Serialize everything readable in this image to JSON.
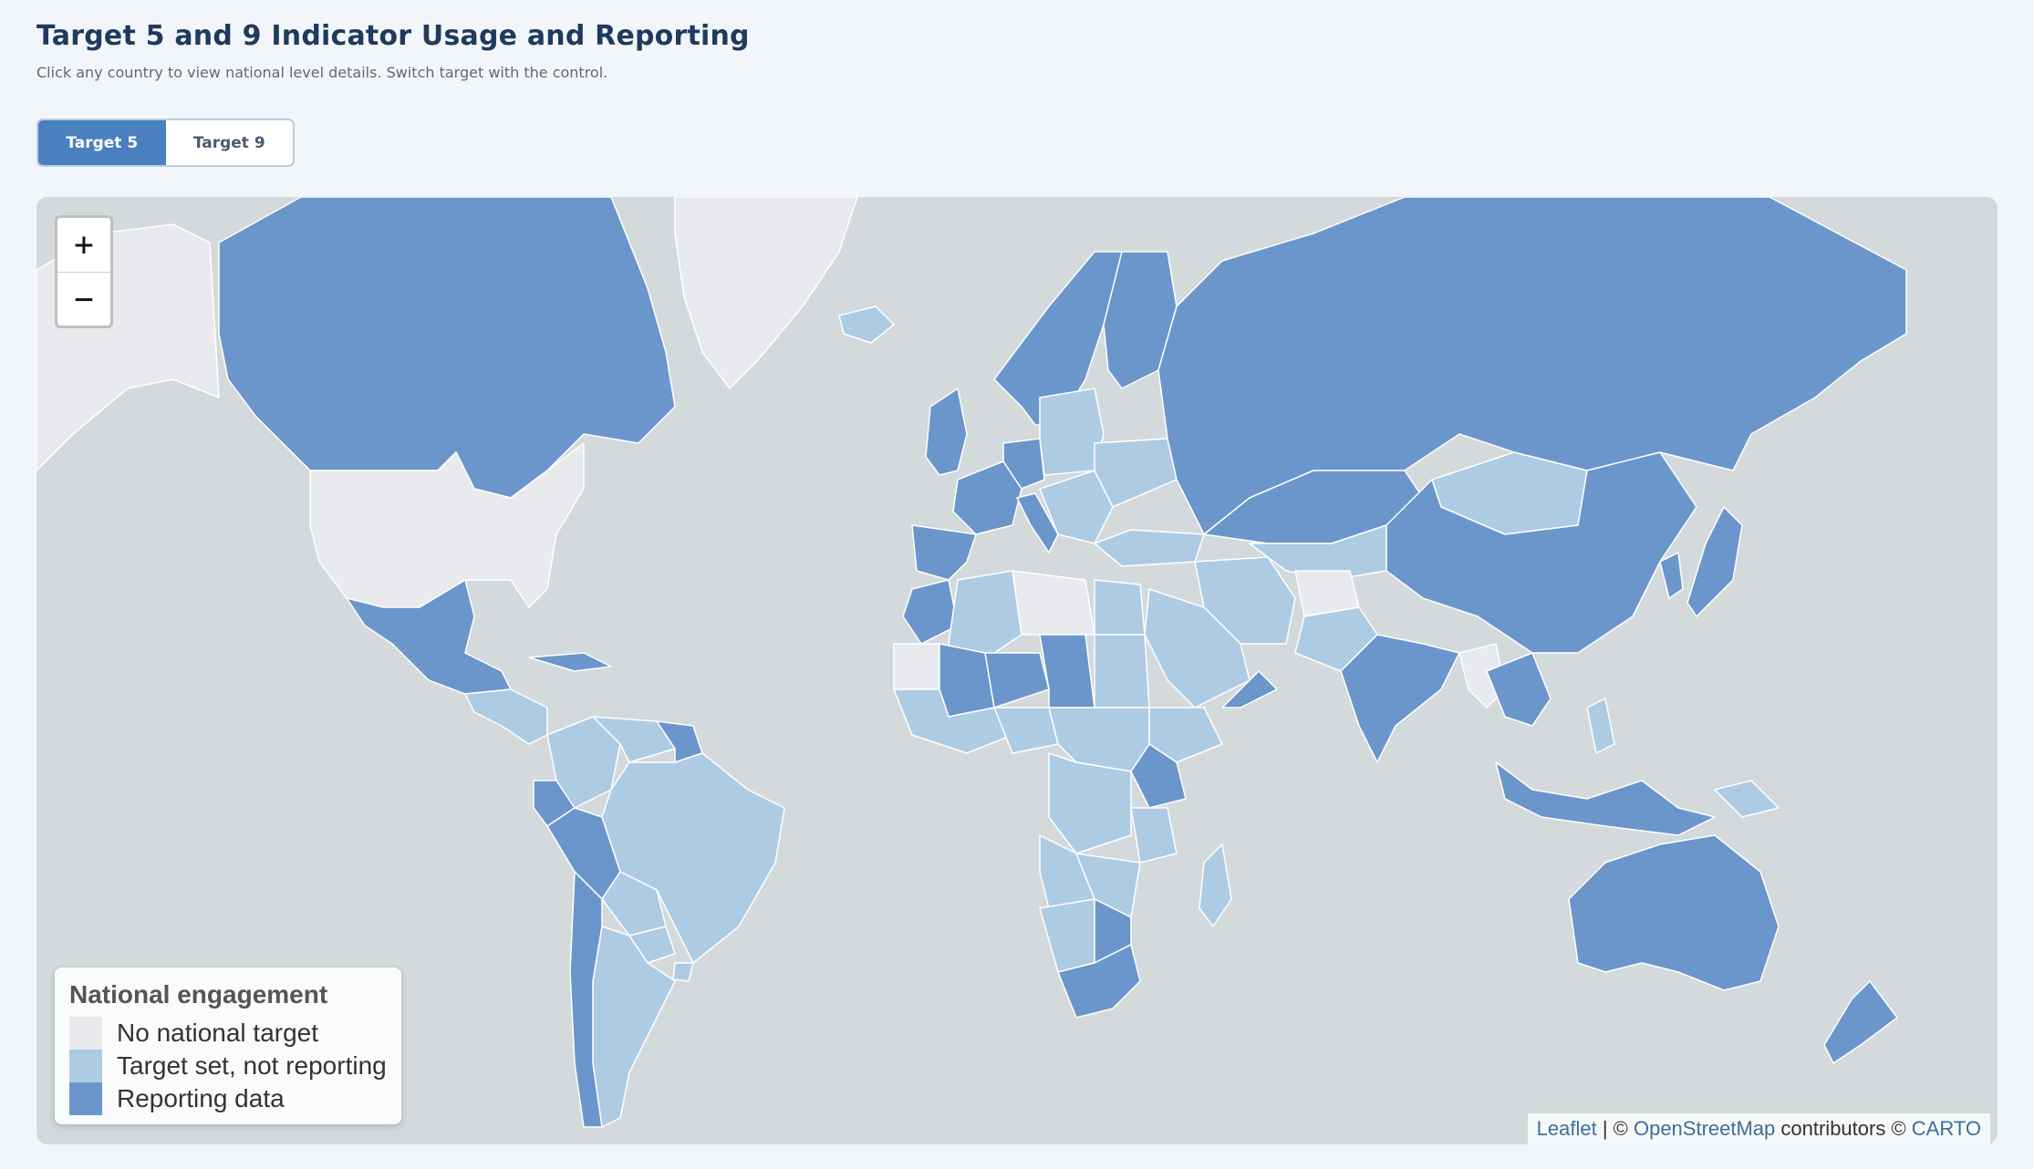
{
  "header": {
    "title": "Target 5 and 9 Indicator Usage and Reporting",
    "subtitle": "Click any country to view national level details. Switch target with the control."
  },
  "toggle": {
    "options": [
      "Target 5",
      "Target 9"
    ],
    "selected": "Target 5"
  },
  "zoom": {
    "in_label": "+",
    "out_label": "−"
  },
  "legend": {
    "title": "National engagement",
    "items": [
      {
        "label": "No national target",
        "color": "#e8eaee"
      },
      {
        "label": "Target set, not reporting",
        "color": "#aecbe4"
      },
      {
        "label": "Reporting data",
        "color": "#6b96cb"
      }
    ]
  },
  "attribution": {
    "leaflet": "Leaflet",
    "sep": " | © ",
    "osm": "OpenStreetMap",
    "contrib": " contributors © ",
    "carto": "CARTO"
  },
  "colors": {
    "ocean": "#d4d9dc",
    "no_target": "#e8eaee",
    "not_reporting": "#aecbe4",
    "reporting": "#6b96cb",
    "accent": "#4a7fc0",
    "land_unclassified": "#eef0f1"
  },
  "countries": [
    {
      "id": "greenland",
      "status": "none"
    },
    {
      "id": "alaska",
      "status": "none"
    },
    {
      "id": "canada",
      "status": "reporting"
    },
    {
      "id": "usa",
      "status": "none"
    },
    {
      "id": "mexico",
      "status": "reporting"
    },
    {
      "id": "central-america",
      "status": "not_reporting"
    },
    {
      "id": "cuba",
      "status": "reporting"
    },
    {
      "id": "colombia",
      "status": "not_reporting"
    },
    {
      "id": "venezuela",
      "status": "not_reporting"
    },
    {
      "id": "guyana-suriname",
      "status": "reporting"
    },
    {
      "id": "ecuador",
      "status": "reporting"
    },
    {
      "id": "peru",
      "status": "reporting"
    },
    {
      "id": "brazil",
      "status": "not_reporting"
    },
    {
      "id": "bolivia",
      "status": "not_reporting"
    },
    {
      "id": "paraguay",
      "status": "not_reporting"
    },
    {
      "id": "uruguay",
      "status": "not_reporting"
    },
    {
      "id": "argentina",
      "status": "not_reporting"
    },
    {
      "id": "chile",
      "status": "reporting"
    },
    {
      "id": "iceland",
      "status": "not_reporting"
    },
    {
      "id": "uk-ireland",
      "status": "reporting"
    },
    {
      "id": "scandinavia",
      "status": "reporting"
    },
    {
      "id": "finland",
      "status": "reporting"
    },
    {
      "id": "france",
      "status": "reporting"
    },
    {
      "id": "iberia",
      "status": "reporting"
    },
    {
      "id": "germany",
      "status": "reporting"
    },
    {
      "id": "poland-baltics",
      "status": "not_reporting"
    },
    {
      "id": "italy",
      "status": "reporting"
    },
    {
      "id": "balkans",
      "status": "not_reporting"
    },
    {
      "id": "ukraine",
      "status": "not_reporting"
    },
    {
      "id": "turkey",
      "status": "not_reporting"
    },
    {
      "id": "russia",
      "status": "reporting"
    },
    {
      "id": "kazakhstan",
      "status": "reporting"
    },
    {
      "id": "central-asia",
      "status": "not_reporting"
    },
    {
      "id": "mongolia",
      "status": "not_reporting"
    },
    {
      "id": "china",
      "status": "reporting"
    },
    {
      "id": "korea",
      "status": "reporting"
    },
    {
      "id": "japan",
      "status": "reporting"
    },
    {
      "id": "iran",
      "status": "not_reporting"
    },
    {
      "id": "afghanistan",
      "status": "none"
    },
    {
      "id": "pakistan",
      "status": "not_reporting"
    },
    {
      "id": "saudi-arabia",
      "status": "not_reporting"
    },
    {
      "id": "oman",
      "status": "reporting"
    },
    {
      "id": "india",
      "status": "reporting"
    },
    {
      "id": "myanmar",
      "status": "none"
    },
    {
      "id": "thailand-indochina",
      "status": "reporting"
    },
    {
      "id": "malaysia-indonesia",
      "status": "reporting"
    },
    {
      "id": "philippines",
      "status": "not_reporting"
    },
    {
      "id": "png",
      "status": "not_reporting"
    },
    {
      "id": "australia",
      "status": "reporting"
    },
    {
      "id": "new-zealand",
      "status": "reporting"
    },
    {
      "id": "morocco",
      "status": "reporting"
    },
    {
      "id": "algeria",
      "status": "not_reporting"
    },
    {
      "id": "libya",
      "status": "none"
    },
    {
      "id": "egypt",
      "status": "not_reporting"
    },
    {
      "id": "mauritania",
      "status": "none"
    },
    {
      "id": "mali",
      "status": "reporting"
    },
    {
      "id": "niger",
      "status": "reporting"
    },
    {
      "id": "chad",
      "status": "reporting"
    },
    {
      "id": "sudan",
      "status": "not_reporting"
    },
    {
      "id": "west-africa",
      "status": "not_reporting"
    },
    {
      "id": "nigeria",
      "status": "not_reporting"
    },
    {
      "id": "ethiopia",
      "status": "not_reporting"
    },
    {
      "id": "kenya",
      "status": "reporting"
    },
    {
      "id": "central-africa",
      "status": "not_reporting"
    },
    {
      "id": "congo",
      "status": "not_reporting"
    },
    {
      "id": "tanzania",
      "status": "not_reporting"
    },
    {
      "id": "angola",
      "status": "not_reporting"
    },
    {
      "id": "zambia-zimbabwe",
      "status": "not_reporting"
    },
    {
      "id": "namibia",
      "status": "not_reporting"
    },
    {
      "id": "botswana",
      "status": "reporting"
    },
    {
      "id": "south-africa",
      "status": "reporting"
    },
    {
      "id": "madagascar",
      "status": "not_reporting"
    }
  ]
}
